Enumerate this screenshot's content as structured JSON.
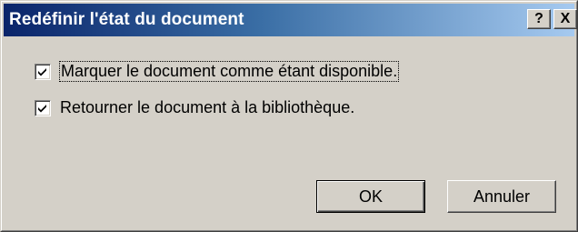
{
  "window": {
    "title": "Redéfinir l'état du document",
    "help_label": "?",
    "close_label": "X"
  },
  "options": [
    {
      "label": "Marquer le document comme étant disponible.",
      "checked": true,
      "focused": true
    },
    {
      "label": "Retourner le document à la bibliothèque.",
      "checked": true,
      "focused": false
    }
  ],
  "buttons": {
    "ok_label": "OK",
    "cancel_label": "Annuler"
  },
  "colors": {
    "dialog_bg": "#d4d0c8",
    "titlebar_start": "#0a246a",
    "titlebar_end": "#a6caf0",
    "title_text": "#ffffff"
  },
  "icons": {
    "check": "check-mark-icon"
  }
}
